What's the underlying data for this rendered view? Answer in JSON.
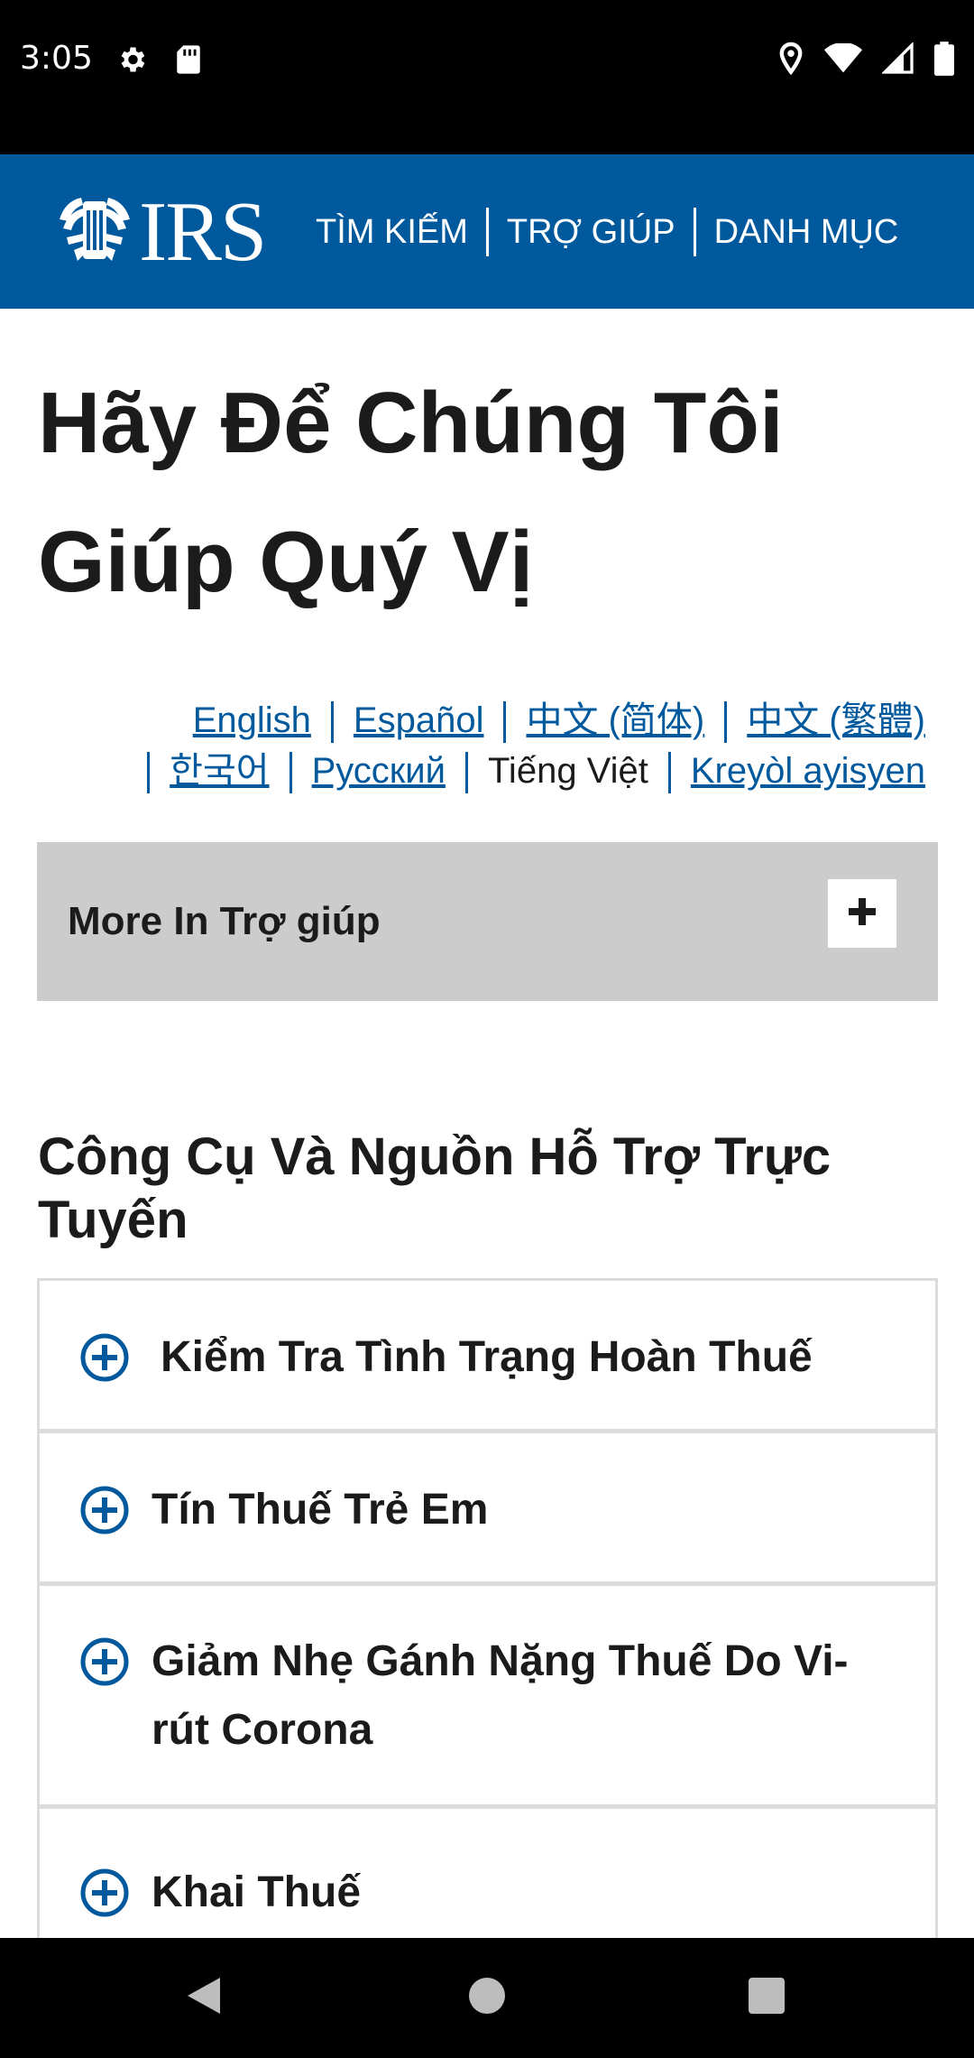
{
  "status_bar": {
    "time": "3:05",
    "left_icons": [
      "gear-icon",
      "sd-card-icon"
    ],
    "right_icons": [
      "location-icon",
      "wifi-icon",
      "signal-icon",
      "battery-icon"
    ]
  },
  "header": {
    "logo_text": "IRS",
    "nav": [
      {
        "label": "TÌM KIẾM"
      },
      {
        "label": "TRỢ GIÚP"
      },
      {
        "label": "DANH MỤC"
      }
    ],
    "color": "#00599c"
  },
  "page_title": "Hãy Để Chúng Tôi Giúp Quý Vị",
  "languages": [
    {
      "label": "English",
      "current": false
    },
    {
      "label": "Español",
      "current": false
    },
    {
      "label": "中文 (简体)",
      "current": false
    },
    {
      "label": "中文 (繁體)",
      "current": false
    },
    {
      "label": "한국어",
      "current": false
    },
    {
      "label": "Русский",
      "current": false
    },
    {
      "label": "Tiếng Việt",
      "current": true
    },
    {
      "label": "Kreyòl ayisyen",
      "current": false
    }
  ],
  "more_panel": {
    "label": "More In Trợ giúp",
    "toggle_icon": "plus-icon"
  },
  "section_heading": "Công Cụ Và Nguồn Hỗ Trợ Trực Tuyến",
  "accordion": [
    {
      "label": "Kiểm Tra Tình Trạng Hoàn Thuế"
    },
    {
      "label": "Tín Thuế Trẻ Em"
    },
    {
      "label": "Giảm Nhẹ Gánh Nặng Thuế Do Vi-rút Corona"
    },
    {
      "label": "Khai Thuế"
    }
  ],
  "nav_bar": {
    "buttons": [
      "back-icon",
      "home-icon",
      "recents-icon"
    ]
  }
}
